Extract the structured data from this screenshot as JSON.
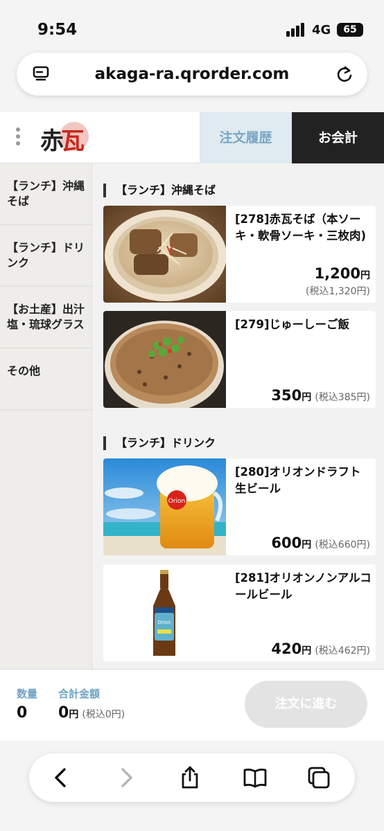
{
  "status_bar": {
    "time": "9:54",
    "network": "4G",
    "battery": "65"
  },
  "browser": {
    "url": "akaga-ra.qrorder.com"
  },
  "header": {
    "order_history_label": "注文履歴",
    "checkout_label": "お会計"
  },
  "sidebar": {
    "items": [
      {
        "label": "【ランチ】沖縄そば"
      },
      {
        "label": "【ランチ】ドリンク"
      },
      {
        "label": "【お土産】出汁塩・琉球グラス"
      },
      {
        "label": "その他"
      }
    ]
  },
  "sections": [
    {
      "title": "【ランチ】沖縄そば",
      "items": [
        {
          "name": "[278]赤瓦そば（本ソーキ・軟骨ソーキ・三枚肉)",
          "price": "1,200",
          "yen": "円",
          "tax": "(税込1,320円)"
        },
        {
          "name": "[279]じゅーしーご飯",
          "price": "350",
          "yen": "円",
          "tax": "(税込385円)"
        }
      ]
    },
    {
      "title": "【ランチ】ドリンク",
      "items": [
        {
          "name": "[280]オリオンドラフト生ビール",
          "price": "600",
          "yen": "円",
          "tax": "(税込660円)"
        },
        {
          "name": "[281]オリオンノンアルコールビール",
          "price": "420",
          "yen": "円",
          "tax": "(税込462円)"
        }
      ]
    }
  ],
  "order_bar": {
    "qty_label": "数量",
    "qty": "0",
    "total_label": "合計金額",
    "total": "0",
    "yen": "円",
    "total_tax": "(税込0円)",
    "submit_label": "注文に進む"
  },
  "icons": {
    "tabs": "tabs-icon",
    "reload": "reload-icon",
    "back": "chevron-left-icon",
    "forward": "chevron-right-icon",
    "share": "share-icon",
    "bookmarks": "book-icon",
    "tab_switcher": "tabs-overview-icon"
  },
  "colors": {
    "accent_blue": "#6fa2c5",
    "history_bg": "#dfeaf1",
    "checkout_bg": "#222222"
  }
}
